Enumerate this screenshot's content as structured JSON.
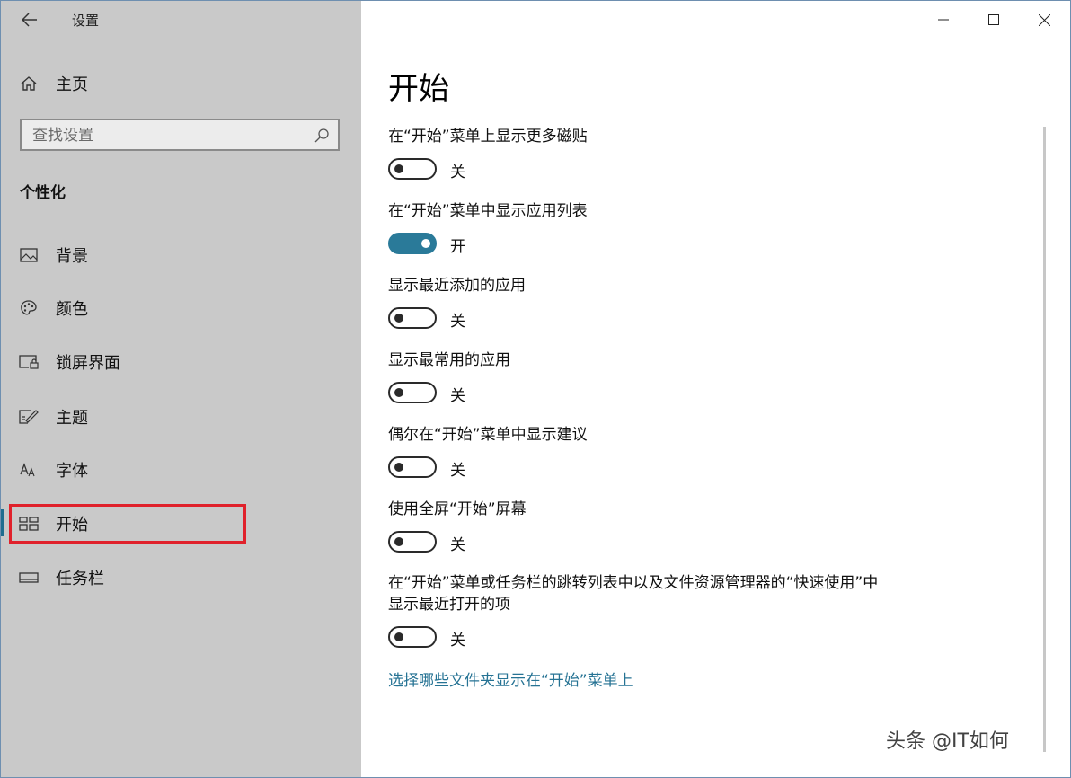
{
  "window": {
    "title": "设置"
  },
  "sidebar": {
    "home_label": "主页",
    "search_placeholder": "查找设置",
    "section_title": "个性化",
    "items": [
      {
        "label": "背景",
        "icon": "picture-icon"
      },
      {
        "label": "颜色",
        "icon": "palette-icon"
      },
      {
        "label": "锁屏界面",
        "icon": "lock-screen-icon"
      },
      {
        "label": "主题",
        "icon": "theme-brush-icon"
      },
      {
        "label": "字体",
        "icon": "font-icon"
      },
      {
        "label": "开始",
        "icon": "start-grid-icon",
        "selected": true
      },
      {
        "label": "任务栏",
        "icon": "taskbar-icon"
      }
    ]
  },
  "main": {
    "title": "开始",
    "settings": [
      {
        "label": "在“开始”菜单上显示更多磁贴",
        "state": "关",
        "on": false
      },
      {
        "label": "在“开始”菜单中显示应用列表",
        "state": "开",
        "on": true
      },
      {
        "label": "显示最近添加的应用",
        "state": "关",
        "on": false
      },
      {
        "label": "显示最常用的应用",
        "state": "关",
        "on": false
      },
      {
        "label": "偶尔在“开始”菜单中显示建议",
        "state": "关",
        "on": false
      },
      {
        "label": "使用全屏“开始”屏幕",
        "state": "关",
        "on": false
      },
      {
        "label_line1": "在“开始”菜单或任务栏的跳转列表中以及文件资源管理器的“快速使用”中",
        "label_line2": "显示最近打开的项",
        "state": "关",
        "on": false
      }
    ],
    "link": "选择哪些文件夹显示在“开始”菜单上"
  },
  "colors": {
    "accent": "#2a7a99",
    "link": "#267394",
    "sidebar_bg": "#c9c9c9",
    "highlight": "#e0212b"
  },
  "watermark": {
    "text": "头条 @IT如何"
  }
}
